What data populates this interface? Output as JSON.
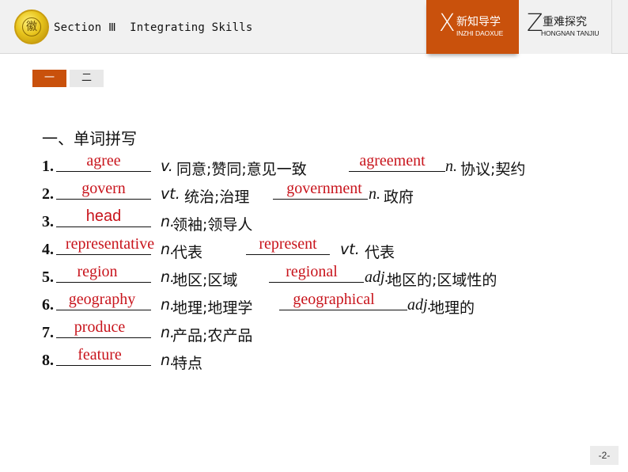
{
  "header": {
    "logo_label": "徽",
    "title": "Section Ⅲ  Integrating Skills",
    "nav": [
      {
        "letter": "X",
        "cn": "新知导学",
        "en": "INZHI DAOXUE",
        "active": true
      },
      {
        "letter": "Z",
        "cn": "重难探究",
        "en": "HONGNAN TANJIU",
        "active": false
      }
    ]
  },
  "tabs": [
    {
      "label": "一",
      "active": true
    },
    {
      "label": "二",
      "active": false
    }
  ],
  "section_heading": "一、单词拼写",
  "items": [
    {
      "num": "1.",
      "answer": "agree",
      "pos": "v.",
      "meaning": "同意;赞同;意见一致",
      "derived_answer": "agreement",
      "derived_pos": "n.",
      "derived_meaning": "协议;契约"
    },
    {
      "num": "2.",
      "answer": "govern",
      "pos": "vt.",
      "meaning": "统治;治理",
      "derived_answer": "government",
      "derived_pos": "n.",
      "derived_meaning": "政府"
    },
    {
      "num": "3.",
      "answer": "head",
      "pos": "n.",
      "meaning": "领袖;领导人"
    },
    {
      "num": "4.",
      "answer": "representative",
      "pos": "n.",
      "meaning": "代表",
      "derived_answer": "represent",
      "derived_pos": "vt.",
      "derived_meaning": "代表"
    },
    {
      "num": "5.",
      "answer": "region",
      "pos": "n.",
      "meaning": "地区;区域",
      "derived_answer": "regional",
      "derived_pos": "adj.",
      "derived_meaning": "地区的;区域性的"
    },
    {
      "num": "6.",
      "answer": "geography",
      "pos": "n.",
      "meaning": "地理;地理学",
      "derived_answer": "geographical",
      "derived_pos": "adj.",
      "derived_meaning": "地理的"
    },
    {
      "num": "7.",
      "answer": "produce",
      "pos": "n.",
      "meaning": "产品;农产品"
    },
    {
      "num": "8.",
      "answer": "feature",
      "pos": "n.",
      "meaning": "特点"
    }
  ],
  "page_number": "-2-",
  "colors": {
    "accent": "#c9510c",
    "answer": "#c8141c"
  }
}
